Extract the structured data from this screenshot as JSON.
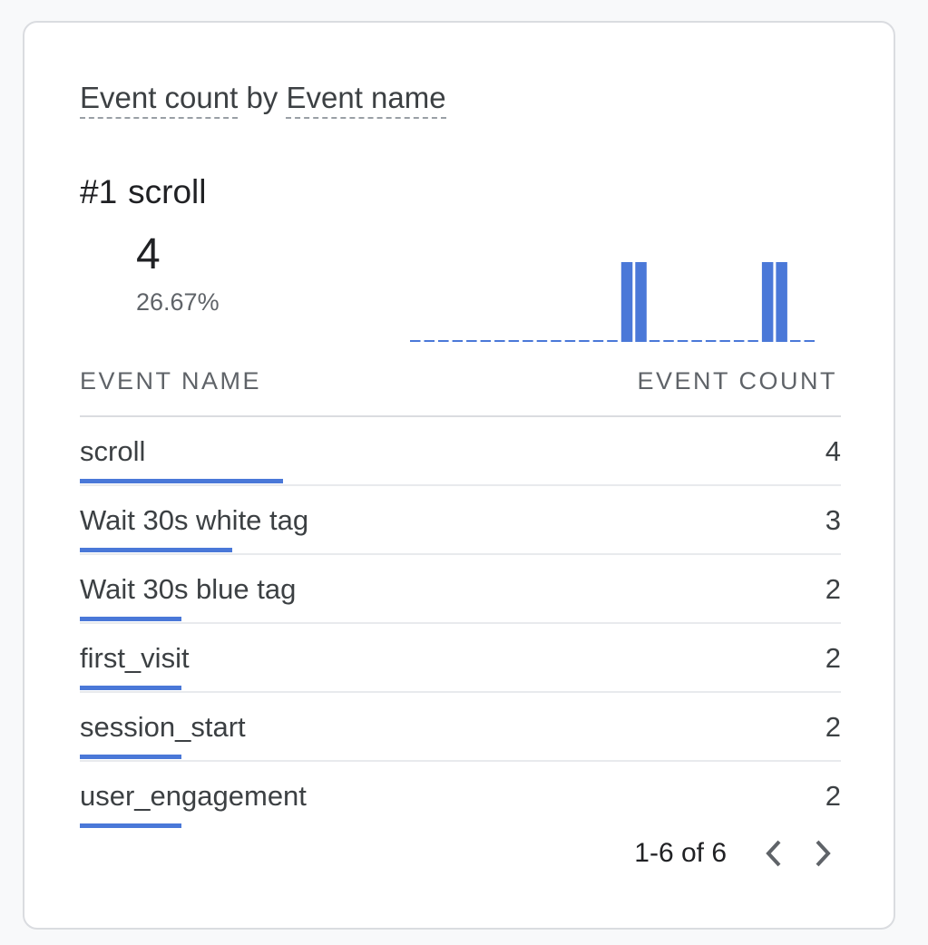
{
  "card": {
    "title_metric": "Event count",
    "title_by": "by",
    "title_dimension": "Event name",
    "top": {
      "rank": "#1",
      "name": "scroll",
      "value": "4",
      "percent": "26.67%"
    },
    "columns": {
      "name": "EVENT NAME",
      "count": "EVENT COUNT"
    },
    "rows": [
      {
        "name": "scroll",
        "count": "4",
        "fraction": 0.2667
      },
      {
        "name": "Wait 30s white tag",
        "count": "3",
        "fraction": 0.2
      },
      {
        "name": "Wait 30s blue tag",
        "count": "2",
        "fraction": 0.1333
      },
      {
        "name": "first_visit",
        "count": "2",
        "fraction": 0.1333
      },
      {
        "name": "session_start",
        "count": "2",
        "fraction": 0.1333
      },
      {
        "name": "user_engagement",
        "count": "2",
        "fraction": 0.1333
      }
    ],
    "pagination": {
      "label": "1-6 of 6",
      "prev_icon": "chevron-left-icon",
      "next_icon": "chevron-right-icon"
    }
  },
  "chart_data": {
    "type": "bar",
    "values": [
      0,
      0,
      0,
      0,
      0,
      0,
      0,
      0,
      0,
      0,
      0,
      0,
      0,
      0,
      0,
      1,
      1,
      0,
      0,
      0,
      0,
      0,
      0,
      0,
      0,
      1,
      1,
      0,
      0
    ],
    "ylim": [
      0,
      1
    ]
  },
  "colors": {
    "accent": "#4a78d8",
    "text": "#3c4043",
    "muted": "#5f6368",
    "divider": "#dadce0"
  }
}
